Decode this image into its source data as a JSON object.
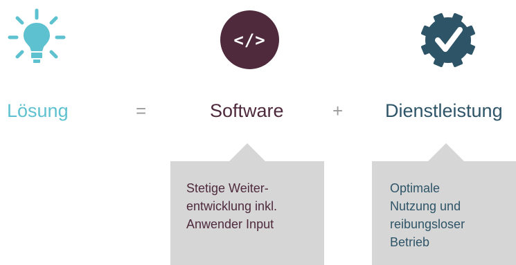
{
  "colors": {
    "loesung": "#5ec1cf",
    "software": "#4e2a3c",
    "dienstleistung": "#2e5467",
    "operator": "#9a9a9a",
    "callout_bg": "#d6d6d6"
  },
  "icons": {
    "loesung": "lightbulb-icon",
    "software": "code-icon",
    "dienstleistung": "gear-checkmark-icon"
  },
  "formula": {
    "loesung": "Lösung",
    "equals": "=",
    "software": "Software",
    "plus": "+",
    "dienstleistung": "Dienstleistung"
  },
  "code_symbol": "</>",
  "callouts": {
    "software": "Stetige Weiter-\nentwicklung inkl.\nAnwender Input",
    "dienstleistung": "Optimale\nNutzung und\nreibungsloser\nBetrieb"
  }
}
